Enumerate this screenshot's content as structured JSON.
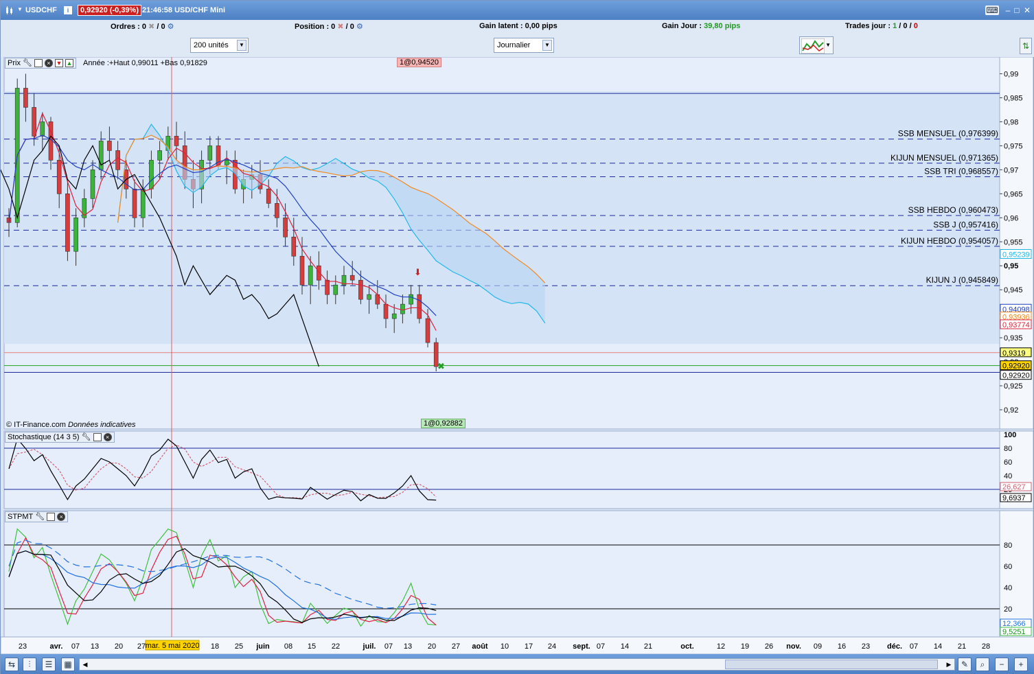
{
  "titlebar": {
    "symbol": "USDCHF",
    "price_badge": "0,92920 (-0,39%)",
    "time_title": "21:46:58 USD/CHF Mini",
    "icons": [
      "keyboard-icon",
      "minimize-icon",
      "maximize-icon",
      "close-icon"
    ]
  },
  "infobar": {
    "orders_label": "Ordres :",
    "orders_value": "0",
    "orders_total": "/ 0",
    "position_label": "Position :",
    "position_value": "0",
    "position_total": "/ 0",
    "gain_latent_label": "Gain latent :",
    "gain_latent_value": "0,00 pips",
    "gain_jour_label": "Gain Jour :",
    "gain_jour_value": "39,80 pips",
    "trades_label": "Trades jour :",
    "trades_win": "1",
    "trades_sep1": "/",
    "trades_loss": "0",
    "trades_sep2": "/",
    "trades_other": "0"
  },
  "controls": {
    "quantity": "200 unités",
    "period": "Journalier"
  },
  "price_panel": {
    "label": "Prix",
    "year_info": "Année :+Haut 0,99011 +Bas 0,91829",
    "order_high": "1@0,94520",
    "order_low": "1@0,92882",
    "copyright": "© IT-Finance.com",
    "disclaimer": "Données indicatives",
    "axis_ticks": [
      "0,99",
      "0,985",
      "0,98",
      "0,975",
      "0,97",
      "0,965",
      "0,96",
      "0,955",
      "0,95",
      "0,945",
      "0,94",
      "0,935",
      "0,93",
      "0,925",
      "0,92"
    ],
    "levels": [
      {
        "label": "SSB MENSUEL (0,976399)",
        "value": 0.976399
      },
      {
        "label": "KIJUN MENSUEL (0,971365)",
        "value": 0.971365
      },
      {
        "label": "SSB TRI (0,968557)",
        "value": 0.968557
      },
      {
        "label": "SSB HEBDO (0,960473)",
        "value": 0.960473
      },
      {
        "label": "SSB J (0,957416)",
        "value": 0.957416
      },
      {
        "label": "KIJUN HEBDO (0,954057)",
        "value": 0.954057
      },
      {
        "label": "KIJUN J (0,945849)",
        "value": 0.945849
      }
    ],
    "price_tags": [
      {
        "text": "0,95239",
        "color": "#22b8e8",
        "value": 0.95239
      },
      {
        "text": "0,94098",
        "color": "#2040c0",
        "value": 0.94098
      },
      {
        "text": "0,93936",
        "color": "#f08a20",
        "value": 0.93936
      },
      {
        "text": "0,93774",
        "color": "#e0203a",
        "value": 0.93774
      },
      {
        "text": "0,9319",
        "color": "#000000",
        "value": 0.9319
      },
      {
        "text": "0,92920",
        "color": "#000000",
        "value": 0.9292
      },
      {
        "text": "0,92920",
        "color": "#000000",
        "value": 0.9292
      }
    ]
  },
  "stoch_panel": {
    "label": "Stochastique (14 3 5)",
    "axis_ticks": [
      "100",
      "80",
      "60",
      "40",
      "20"
    ],
    "value_k": "26,627",
    "value_d": "9,6937"
  },
  "stpmt_panel": {
    "label": "STPMT",
    "axis_ticks": [
      "80",
      "60",
      "40",
      "20"
    ],
    "value_a": "12,366",
    "value_b": "9,5251"
  },
  "xaxis": {
    "labels": [
      "23",
      "avr.",
      "07",
      "13",
      "20",
      "27",
      "18",
      "25",
      "juin",
      "08",
      "15",
      "22",
      "juil.",
      "07",
      "13",
      "20",
      "27",
      "août",
      "10",
      "17",
      "24",
      "sept.",
      "07",
      "14",
      "21",
      "oct.",
      "12",
      "19",
      "26",
      "nov.",
      "09",
      "16",
      "23",
      "déc.",
      "07",
      "14",
      "21",
      "28"
    ],
    "cursor_label": "mar. 5 mai 2020"
  },
  "colors": {
    "tenkan": "#e0203a",
    "kijun": "#2040c0",
    "ssa": "#22b8e8",
    "ssb": "#f08a20",
    "chikou": "#000000",
    "bull": "#3cb43c",
    "bear": "#d83c3c"
  },
  "chart_data": {
    "type": "candlestick",
    "y_range": [
      0.916,
      0.9935
    ],
    "candles": [
      [
        0.96,
        0.962,
        0.956,
        0.959
      ],
      [
        0.959,
        0.989,
        0.958,
        0.987
      ],
      [
        0.987,
        0.99,
        0.98,
        0.983
      ],
      [
        0.983,
        0.986,
        0.975,
        0.977
      ],
      [
        0.977,
        0.982,
        0.974,
        0.98
      ],
      [
        0.98,
        0.981,
        0.97,
        0.972
      ],
      [
        0.972,
        0.975,
        0.962,
        0.965
      ],
      [
        0.965,
        0.968,
        0.951,
        0.953
      ],
      [
        0.953,
        0.962,
        0.95,
        0.96
      ],
      [
        0.96,
        0.966,
        0.958,
        0.964
      ],
      [
        0.964,
        0.972,
        0.962,
        0.97
      ],
      [
        0.97,
        0.978,
        0.968,
        0.976
      ],
      [
        0.976,
        0.979,
        0.972,
        0.974
      ],
      [
        0.974,
        0.976,
        0.968,
        0.97
      ],
      [
        0.97,
        0.972,
        0.964,
        0.966
      ],
      [
        0.966,
        0.968,
        0.958,
        0.96
      ],
      [
        0.96,
        0.968,
        0.958,
        0.966
      ],
      [
        0.966,
        0.974,
        0.964,
        0.972
      ],
      [
        0.972,
        0.976,
        0.968,
        0.974
      ],
      [
        0.974,
        0.979,
        0.972,
        0.977
      ],
      [
        0.977,
        0.98,
        0.972,
        0.975
      ],
      [
        0.975,
        0.978,
        0.966,
        0.968
      ],
      [
        0.968,
        0.972,
        0.962,
        0.966
      ],
      [
        0.966,
        0.974,
        0.963,
        0.972
      ],
      [
        0.972,
        0.977,
        0.969,
        0.975
      ],
      [
        0.975,
        0.977,
        0.97,
        0.971
      ],
      [
        0.971,
        0.974,
        0.967,
        0.972
      ],
      [
        0.972,
        0.974,
        0.965,
        0.966
      ],
      [
        0.966,
        0.97,
        0.963,
        0.968
      ],
      [
        0.968,
        0.971,
        0.964,
        0.969
      ],
      [
        0.969,
        0.972,
        0.965,
        0.966
      ],
      [
        0.966,
        0.968,
        0.962,
        0.963
      ],
      [
        0.963,
        0.966,
        0.958,
        0.96
      ],
      [
        0.96,
        0.963,
        0.954,
        0.956
      ],
      [
        0.956,
        0.96,
        0.95,
        0.952
      ],
      [
        0.952,
        0.956,
        0.944,
        0.946
      ],
      [
        0.946,
        0.952,
        0.942,
        0.95
      ],
      [
        0.95,
        0.953,
        0.945,
        0.947
      ],
      [
        0.947,
        0.949,
        0.942,
        0.944
      ],
      [
        0.944,
        0.948,
        0.942,
        0.946
      ],
      [
        0.946,
        0.95,
        0.944,
        0.948
      ],
      [
        0.948,
        0.951,
        0.946,
        0.947
      ],
      [
        0.947,
        0.949,
        0.942,
        0.943
      ],
      [
        0.943,
        0.946,
        0.94,
        0.944
      ],
      [
        0.944,
        0.947,
        0.941,
        0.942
      ],
      [
        0.942,
        0.944,
        0.937,
        0.939
      ],
      [
        0.939,
        0.942,
        0.936,
        0.94
      ],
      [
        0.94,
        0.944,
        0.938,
        0.942
      ],
      [
        0.942,
        0.946,
        0.94,
        0.944
      ],
      [
        0.944,
        0.946,
        0.938,
        0.939
      ],
      [
        0.939,
        0.941,
        0.933,
        0.934
      ],
      [
        0.934,
        0.935,
        0.928,
        0.929
      ]
    ]
  }
}
